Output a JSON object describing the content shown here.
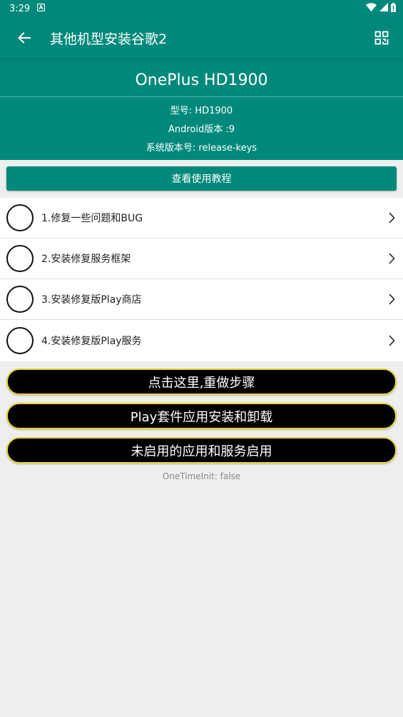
{
  "status_bar": {
    "time": "3:29"
  },
  "app_bar": {
    "title": "其他机型安装谷歌2"
  },
  "device": {
    "name": "OnePlus HD1900",
    "model_line": "型号: HD1900",
    "android_line": "Android版本 :9",
    "build_line": "系统版本号: release-keys"
  },
  "tutorial_button": "查看使用教程",
  "steps": [
    {
      "label": "1.修复一些问题和BUG"
    },
    {
      "label": "2.安装修复服务框架"
    },
    {
      "label": "3.安装修复版Play商店"
    },
    {
      "label": "4.安装修复版Play服务"
    }
  ],
  "actions": {
    "redo": "点击这里,重做步骤",
    "play_suite": "Play套件应用安装和卸载",
    "enable_apps": "未启用的应用和服务启用"
  },
  "footer": {
    "one_time_init": "OneTimeInit: false"
  },
  "colors": {
    "primary": "#00897b",
    "action_border": "#e6d53a",
    "background": "#eeeeee"
  }
}
